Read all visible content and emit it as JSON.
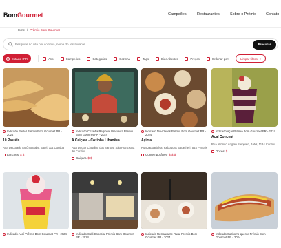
{
  "header": {
    "logo_part1": "Bom",
    "logo_part2": "Gourmet",
    "nav": [
      "Campeões",
      "Restaurantes",
      "Sobre o Prêmio",
      "Contato"
    ]
  },
  "breadcrumb": {
    "home": "Home",
    "separator": "/",
    "current": "Prêmio Bom Gourmet"
  },
  "search": {
    "placeholder": "Pesquise no site por cozinha, nome do restaurante...",
    "button": "Procurar"
  },
  "filters": [
    {
      "label": "Estado : PR",
      "active": true
    },
    {
      "label": "Ano"
    },
    {
      "label": "Campeões"
    },
    {
      "label": "Categorias"
    },
    {
      "label": "Cozinha"
    },
    {
      "label": "Tags"
    },
    {
      "label": "Dias Abertos"
    },
    {
      "label": "Preços"
    },
    {
      "label": "Ordenar por:"
    }
  ],
  "clear_filters": "Limpar filtros",
  "cards": [
    {
      "award": "Indicado Pastel Prêmio Bom Gourmet PR - 2024",
      "title": "10 Pastéis",
      "address": "Rua Deputado Antônio Baby, Batel, 114 Curitiba",
      "category": "Lanches",
      "price": "$ $"
    },
    {
      "award": "Indicado Cozinha Regional Brasileira Prêmio Bom Gourmet PR - 2024",
      "title": "A Caiçara - Cozinha Libanêsa",
      "address": "Rua Doutor Claudino dos Santos, São Francisco, 90 Curitiba",
      "category": "Caiçara",
      "price": "$ $"
    },
    {
      "award": "Indicado Novidades Prêmio Bom Gourmet PR - 2024",
      "title": "Açima",
      "address": "Rua Jaguariaíva, Rebouças Bacacheri, 544 Pinhais",
      "category": "Contemporâneo",
      "price": "$ $ $"
    },
    {
      "award": "Indicado Açaí Prêmio Bom Gourmet PR - 2024",
      "title": "Açaí Concept",
      "address": "Rua Alfonso Ângelo Sampaio, Batel, 1124 Curitiba",
      "category": "Doces",
      "price": "$"
    },
    {
      "award": "Indicado Açaí Prêmio Bom Gourmet PR - 2024",
      "title": "",
      "address": "",
      "category": "",
      "price": ""
    },
    {
      "award": "Indicado Café Especial Prêmio Bom Gourmet PR - 2024",
      "title": "",
      "address": "",
      "category": "",
      "price": ""
    },
    {
      "award": "Indicado Restaurante Rural Prêmio Bom Gourmet PR - 2024",
      "title": "",
      "address": "",
      "category": "",
      "price": ""
    },
    {
      "award": "Indicado Cachorro-quente Prêmio Bom Gourmet PR - 2024",
      "title": "",
      "address": "",
      "category": "",
      "price": ""
    }
  ],
  "colors": {
    "brand": "#d01f35",
    "button": "#111111"
  }
}
